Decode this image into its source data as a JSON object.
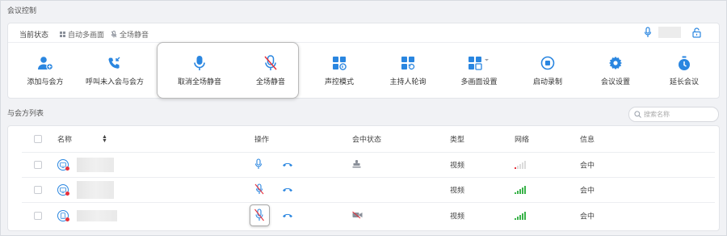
{
  "sections": {
    "conference_control": "会议控制",
    "participant_list": "与会方列表"
  },
  "status": {
    "label": "当前状态",
    "chips": [
      "自动多画面",
      "全场静音"
    ]
  },
  "toolbar": [
    {
      "id": "add",
      "label": "添加与会方",
      "icon": "add-user-icon"
    },
    {
      "id": "call",
      "label": "呼叫未入会与会方",
      "icon": "phone-incoming-icon"
    },
    {
      "id": "unmute_all",
      "label": "取消全场静音",
      "icon": "microphone-icon"
    },
    {
      "id": "mute_all",
      "label": "全场静音",
      "icon": "microphone-muted-icon"
    },
    {
      "id": "voice_mode",
      "label": "声控模式",
      "icon": "voice-mode-grid-icon"
    },
    {
      "id": "host_poll",
      "label": "主持人轮询",
      "icon": "poll-grid-icon"
    },
    {
      "id": "multi_screen",
      "label": "多画面设置",
      "icon": "multi-screen-grid-icon"
    },
    {
      "id": "record",
      "label": "启动录制",
      "icon": "record-icon"
    },
    {
      "id": "settings",
      "label": "会议设置",
      "icon": "gear-icon"
    },
    {
      "id": "extend",
      "label": "延长会议",
      "icon": "stopwatch-icon"
    }
  ],
  "search": {
    "placeholder": "搜索名称"
  },
  "table": {
    "headers": {
      "name": "名称",
      "op": "操作",
      "state": "会中状态",
      "type": "类型",
      "net": "网络",
      "info": "信息"
    },
    "rows": [
      {
        "type": "视频",
        "info": "会中",
        "mic_muted": false,
        "state_icon": "stamp-icon",
        "signal": "poor",
        "device": "terminal-icon"
      },
      {
        "type": "视频",
        "info": "会中",
        "mic_muted": true,
        "state_icon": "",
        "signal": "good",
        "device": "terminal-icon"
      },
      {
        "type": "视频",
        "info": "会中",
        "mic_muted": true,
        "state_icon": "camera-off-icon",
        "signal": "good",
        "device": "phone-device-icon"
      }
    ]
  },
  "colors": {
    "accent": "#2a86e0",
    "danger": "#e8303a",
    "good": "#3ab34a"
  }
}
